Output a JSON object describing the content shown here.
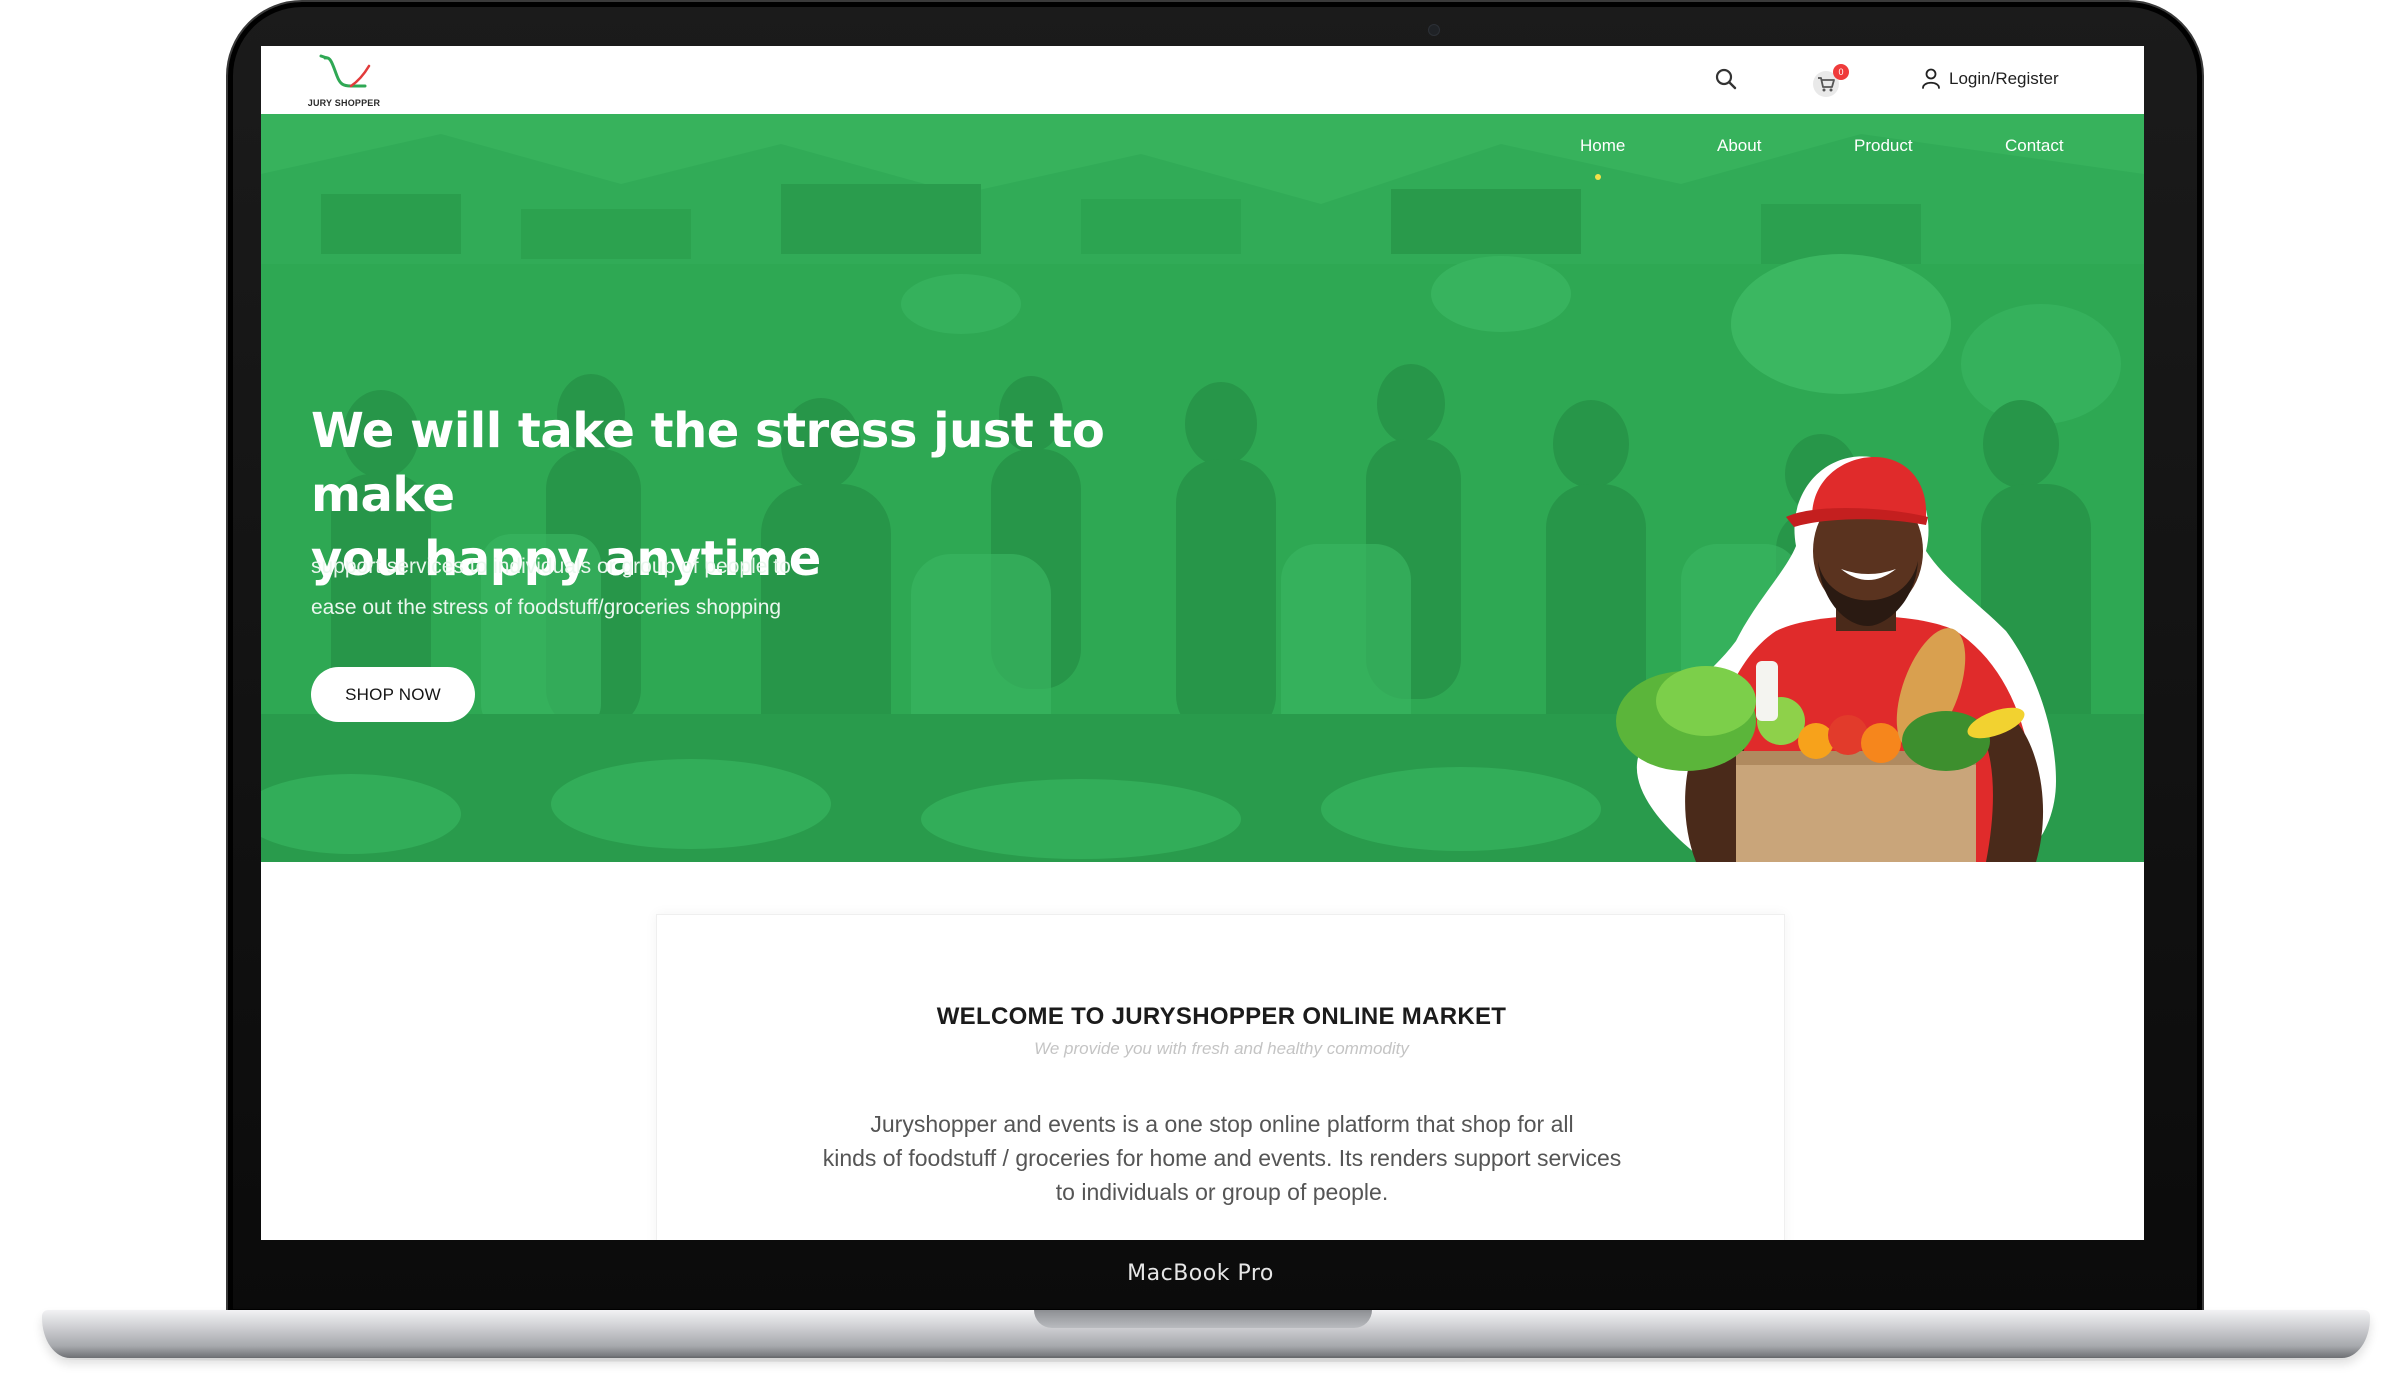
{
  "device": {
    "label": "MacBook Pro"
  },
  "header": {
    "logo_text": "JURY SHOPPER",
    "cart_count": "0",
    "login_label": "Login/Register"
  },
  "nav": {
    "items": [
      {
        "label": "Home",
        "active": true
      },
      {
        "label": "About"
      },
      {
        "label": "Product"
      },
      {
        "label": "Contact"
      }
    ]
  },
  "hero": {
    "title_line1": "We will take the stress just to make",
    "title_line2": "you happy anytime",
    "subtitle_line1": "support services to individuals or group of people to",
    "subtitle_line2": "ease out the stress of foodstuff/groceries shopping",
    "cta": "SHOP NOW"
  },
  "welcome": {
    "title": "WELCOME TO JURYSHOPPER ONLINE MARKET",
    "tagline": "We provide you with fresh and healthy commodity",
    "body_line1": "Juryshopper and events is a one stop online platform that shop for all",
    "body_line2": "kinds of foodstuff / groceries for home and events. Its renders support services",
    "body_line3": "to individuals or group of people."
  },
  "colors": {
    "brand_green": "#2fa854",
    "active_dot": "#f4e04a",
    "badge_red": "#ef3b3b",
    "cap_red": "#e02b2b"
  },
  "icons": [
    "search-icon",
    "cart-icon",
    "user-icon",
    "logo-cart-icon"
  ]
}
